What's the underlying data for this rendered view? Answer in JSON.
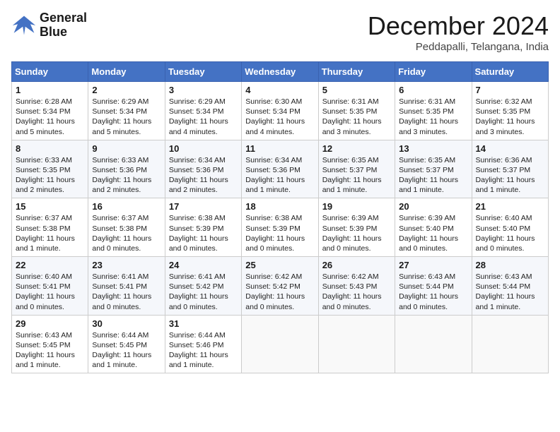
{
  "header": {
    "logo_line1": "General",
    "logo_line2": "Blue",
    "month_title": "December 2024",
    "location": "Peddapalli, Telangana, India"
  },
  "days_of_week": [
    "Sunday",
    "Monday",
    "Tuesday",
    "Wednesday",
    "Thursday",
    "Friday",
    "Saturday"
  ],
  "weeks": [
    [
      {
        "day": "1",
        "sunrise": "6:28 AM",
        "sunset": "5:34 PM",
        "daylight": "11 hours and 5 minutes."
      },
      {
        "day": "2",
        "sunrise": "6:29 AM",
        "sunset": "5:34 PM",
        "daylight": "11 hours and 5 minutes."
      },
      {
        "day": "3",
        "sunrise": "6:29 AM",
        "sunset": "5:34 PM",
        "daylight": "11 hours and 4 minutes."
      },
      {
        "day": "4",
        "sunrise": "6:30 AM",
        "sunset": "5:34 PM",
        "daylight": "11 hours and 4 minutes."
      },
      {
        "day": "5",
        "sunrise": "6:31 AM",
        "sunset": "5:35 PM",
        "daylight": "11 hours and 3 minutes."
      },
      {
        "day": "6",
        "sunrise": "6:31 AM",
        "sunset": "5:35 PM",
        "daylight": "11 hours and 3 minutes."
      },
      {
        "day": "7",
        "sunrise": "6:32 AM",
        "sunset": "5:35 PM",
        "daylight": "11 hours and 3 minutes."
      }
    ],
    [
      {
        "day": "8",
        "sunrise": "6:33 AM",
        "sunset": "5:35 PM",
        "daylight": "11 hours and 2 minutes."
      },
      {
        "day": "9",
        "sunrise": "6:33 AM",
        "sunset": "5:36 PM",
        "daylight": "11 hours and 2 minutes."
      },
      {
        "day": "10",
        "sunrise": "6:34 AM",
        "sunset": "5:36 PM",
        "daylight": "11 hours and 2 minutes."
      },
      {
        "day": "11",
        "sunrise": "6:34 AM",
        "sunset": "5:36 PM",
        "daylight": "11 hours and 1 minute."
      },
      {
        "day": "12",
        "sunrise": "6:35 AM",
        "sunset": "5:37 PM",
        "daylight": "11 hours and 1 minute."
      },
      {
        "day": "13",
        "sunrise": "6:35 AM",
        "sunset": "5:37 PM",
        "daylight": "11 hours and 1 minute."
      },
      {
        "day": "14",
        "sunrise": "6:36 AM",
        "sunset": "5:37 PM",
        "daylight": "11 hours and 1 minute."
      }
    ],
    [
      {
        "day": "15",
        "sunrise": "6:37 AM",
        "sunset": "5:38 PM",
        "daylight": "11 hours and 1 minute."
      },
      {
        "day": "16",
        "sunrise": "6:37 AM",
        "sunset": "5:38 PM",
        "daylight": "11 hours and 0 minutes."
      },
      {
        "day": "17",
        "sunrise": "6:38 AM",
        "sunset": "5:39 PM",
        "daylight": "11 hours and 0 minutes."
      },
      {
        "day": "18",
        "sunrise": "6:38 AM",
        "sunset": "5:39 PM",
        "daylight": "11 hours and 0 minutes."
      },
      {
        "day": "19",
        "sunrise": "6:39 AM",
        "sunset": "5:39 PM",
        "daylight": "11 hours and 0 minutes."
      },
      {
        "day": "20",
        "sunrise": "6:39 AM",
        "sunset": "5:40 PM",
        "daylight": "11 hours and 0 minutes."
      },
      {
        "day": "21",
        "sunrise": "6:40 AM",
        "sunset": "5:40 PM",
        "daylight": "11 hours and 0 minutes."
      }
    ],
    [
      {
        "day": "22",
        "sunrise": "6:40 AM",
        "sunset": "5:41 PM",
        "daylight": "11 hours and 0 minutes."
      },
      {
        "day": "23",
        "sunrise": "6:41 AM",
        "sunset": "5:41 PM",
        "daylight": "11 hours and 0 minutes."
      },
      {
        "day": "24",
        "sunrise": "6:41 AM",
        "sunset": "5:42 PM",
        "daylight": "11 hours and 0 minutes."
      },
      {
        "day": "25",
        "sunrise": "6:42 AM",
        "sunset": "5:42 PM",
        "daylight": "11 hours and 0 minutes."
      },
      {
        "day": "26",
        "sunrise": "6:42 AM",
        "sunset": "5:43 PM",
        "daylight": "11 hours and 0 minutes."
      },
      {
        "day": "27",
        "sunrise": "6:43 AM",
        "sunset": "5:44 PM",
        "daylight": "11 hours and 0 minutes."
      },
      {
        "day": "28",
        "sunrise": "6:43 AM",
        "sunset": "5:44 PM",
        "daylight": "11 hours and 1 minute."
      }
    ],
    [
      {
        "day": "29",
        "sunrise": "6:43 AM",
        "sunset": "5:45 PM",
        "daylight": "11 hours and 1 minute."
      },
      {
        "day": "30",
        "sunrise": "6:44 AM",
        "sunset": "5:45 PM",
        "daylight": "11 hours and 1 minute."
      },
      {
        "day": "31",
        "sunrise": "6:44 AM",
        "sunset": "5:46 PM",
        "daylight": "11 hours and 1 minute."
      },
      null,
      null,
      null,
      null
    ]
  ],
  "labels": {
    "sunrise_prefix": "Sunrise: ",
    "sunset_prefix": "Sunset: ",
    "daylight_prefix": "Daylight: "
  }
}
